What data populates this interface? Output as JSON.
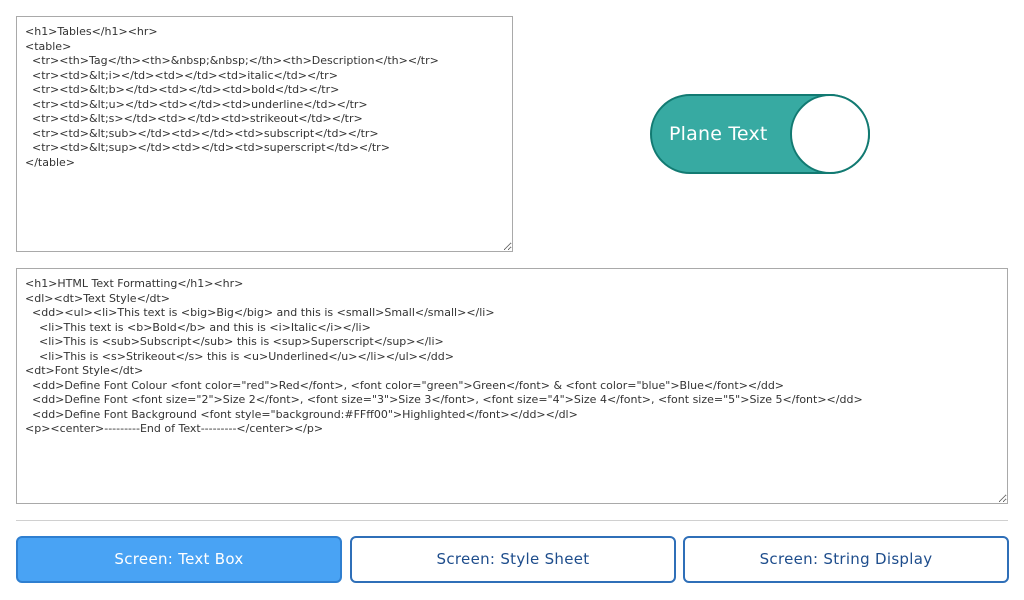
{
  "top_textbox": {
    "content": "<h1>Tables</h1><hr>\n<table>\n  <tr><th>Tag</th><th>&nbsp;&nbsp;</th><th>Description</th></tr>\n  <tr><td>&lt;i></td><td></td><td>italic</td></tr>\n  <tr><td>&lt;b></td><td></td><td>bold</td></tr>\n  <tr><td>&lt;u></td><td></td><td>underline</td></tr>\n  <tr><td>&lt;s></td><td></td><td>strikeout</td></tr>\n  <tr><td>&lt;sub></td><td></td><td>subscript</td></tr>\n  <tr><td>&lt;sup></td><td></td><td>superscript</td></tr>\n</table>"
  },
  "toggle": {
    "label": "Plane Text",
    "state": "on",
    "color": "#37aaa2"
  },
  "bottom_textbox": {
    "content": "<h1>HTML Text Formatting</h1><hr>\n<dl><dt>Text Style</dt>\n  <dd><ul><li>This text is <big>Big</big> and this is <small>Small</small></li>\n    <li>This text is <b>Bold</b> and this is <i>Italic</i></li>\n    <li>This is <sub>Subscript</sub> this is <sup>Superscript</sup></li>\n    <li>This is <s>Strikeout</s> this is <u>Underlined</u></li></ul></dd>\n<dt>Font Style</dt>\n  <dd>Define Font Colour <font color=\"red\">Red</font>, <font color=\"green\">Green</font> & <font color=\"blue\">Blue</font></dd>\n  <dd>Define Font <font size=\"2\">Size 2</font>, <font size=\"3\">Size 3</font>, <font size=\"4\">Size 4</font>, <font size=\"5\">Size 5</font></dd>\n  <dd>Define Font Background <font style=\"background:#FFff00\">Highlighted</font></dd></dl>\n<p><center>---------End of Text---------</center></p>"
  },
  "tabs": [
    {
      "label": "Screen: Text Box",
      "active": true
    },
    {
      "label": "Screen: Style Sheet",
      "active": false
    },
    {
      "label": "Screen: String Display",
      "active": false
    }
  ],
  "colors": {
    "active_tab": "#49a3f4",
    "tab_border": "#2f6fb8",
    "toggle_border": "#127a72"
  }
}
